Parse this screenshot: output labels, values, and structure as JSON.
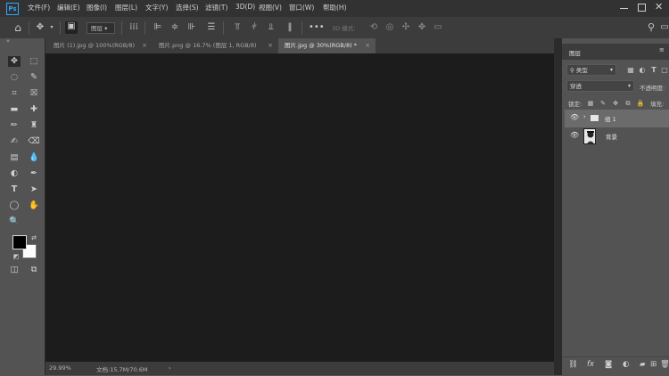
{
  "app": {
    "logo": "Ps"
  },
  "menu": [
    "文件(F)",
    "编辑(E)",
    "图像(I)",
    "图层(L)",
    "文字(Y)",
    "选择(S)",
    "滤镜(T)",
    "3D(D)",
    "视图(V)",
    "窗口(W)",
    "帮助(H)"
  ],
  "options_bar": {
    "auto_select_target": "图层",
    "mode_3d_label": "3D 模式:"
  },
  "tabs": [
    {
      "label": "图片 (1).jpg @ 100%(RGB/8)",
      "active": false
    },
    {
      "label": "图片.png @ 16.7% (图层 1, RGB/8)",
      "active": false
    },
    {
      "label": "图片.jpg @ 30%(RGB/8) *",
      "active": true
    }
  ],
  "tab_close_glyph": "×",
  "status": {
    "zoom": "29.99%",
    "doc_size": "文档:15.7M/70.6M",
    "arrow": "›"
  },
  "layers_panel": {
    "title": "图层",
    "filter_kind": "类型",
    "blend_mode": "穿透",
    "opacity_label": "不透明度:",
    "lock_label": "锁定:",
    "fill_label": "填充:",
    "layers": [
      {
        "name": "组 1",
        "type": "group",
        "visible": true,
        "selected": true
      },
      {
        "name": "背景",
        "type": "image",
        "visible": true,
        "selected": false
      }
    ]
  },
  "colors": {
    "foreground": "#000000",
    "background": "#ffffff",
    "canvas": "#1c1c1c",
    "ui_dark": "#323232",
    "ui_mid": "#535353"
  }
}
